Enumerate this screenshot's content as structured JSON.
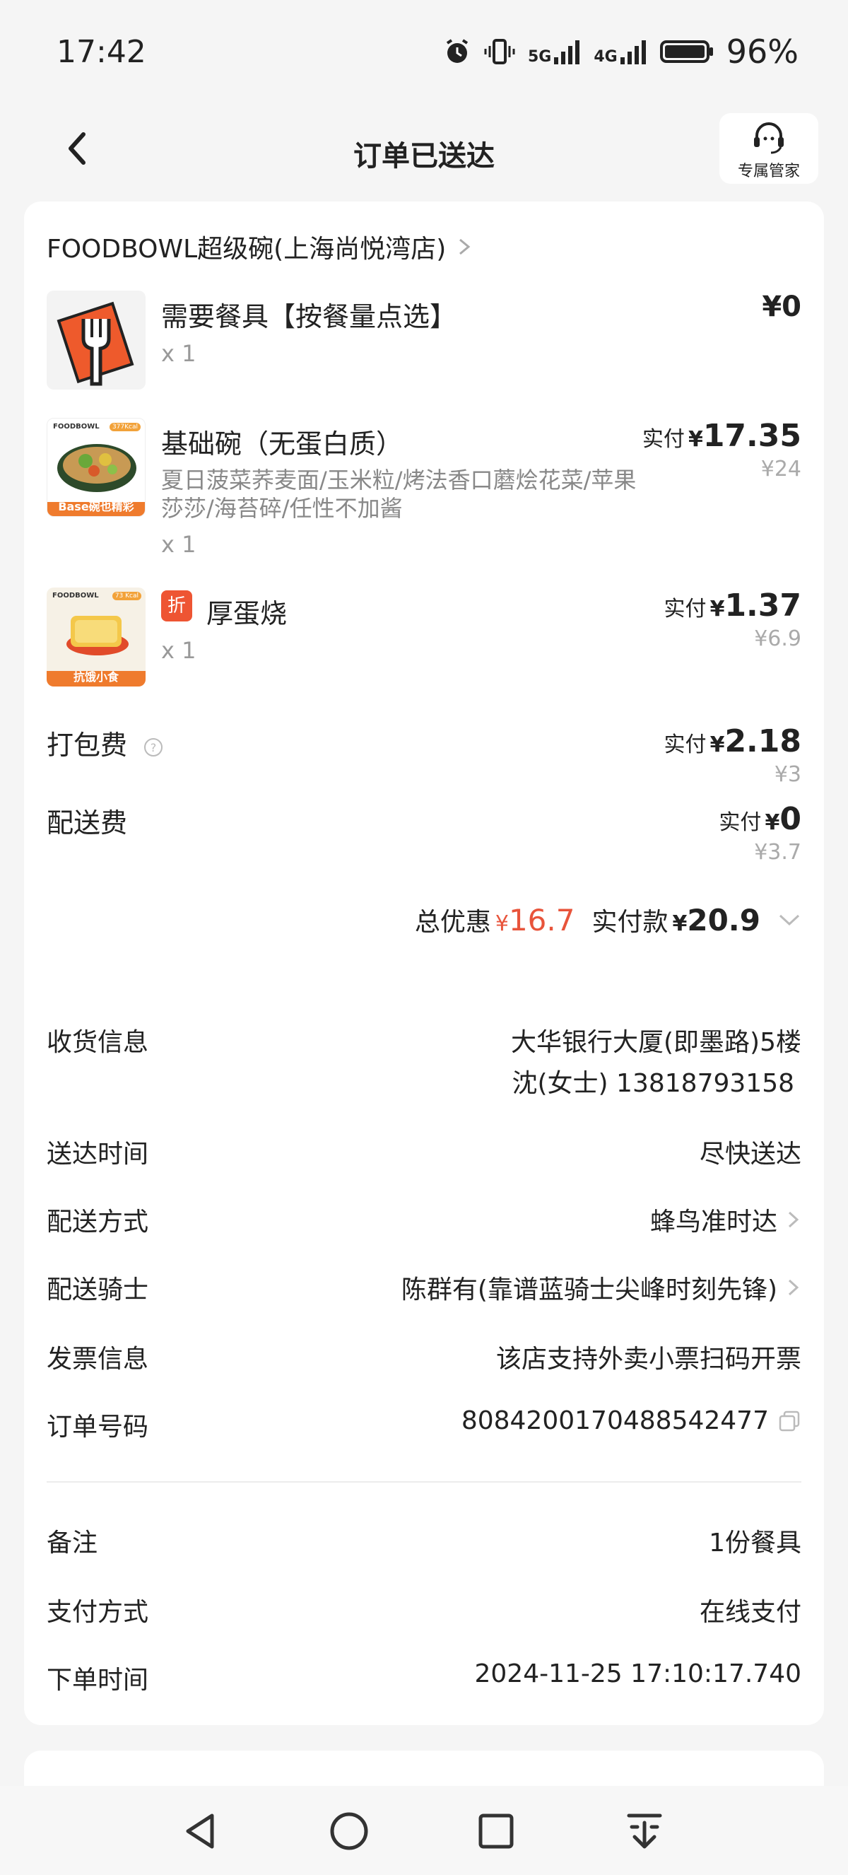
{
  "status_bar": {
    "time": "17:42",
    "signal_5g": "5G",
    "signal_4g": "4G",
    "battery": "96%"
  },
  "header": {
    "title": "订单已送达",
    "service_label": "专属管家"
  },
  "store": {
    "name": "FOODBOWL超级碗(上海尚悦湾店)"
  },
  "items": [
    {
      "name": "需要餐具【按餐量点选】",
      "qty": "x 1",
      "price": "¥0"
    },
    {
      "name": "基础碗（无蛋白质）",
      "desc": "夏日菠菜荞麦面/玉米粒/烤法香口蘑烩花菜/苹果莎莎/海苔碎/任性不加酱",
      "qty": "x 1",
      "pay_label": "实付",
      "pay_yen": "¥",
      "pay_value": "17.35",
      "original": "¥24",
      "thumb_brand": "FOODBOWL",
      "thumb_kcal": "377Kcal",
      "thumb_banner": "Base碗也精彩"
    },
    {
      "tag": "折",
      "name": "厚蛋烧",
      "qty": "x 1",
      "pay_label": "实付",
      "pay_yen": "¥",
      "pay_value": "1.37",
      "original": "¥6.9",
      "thumb_brand": "FOODBOWL",
      "thumb_kcal": "73 Kcal",
      "thumb_banner": "抗饿小食"
    }
  ],
  "fees": {
    "packing": {
      "label": "打包费",
      "pay_label": "实付",
      "pay_yen": "¥",
      "pay_value": "2.18",
      "original": "¥3"
    },
    "delivery": {
      "label": "配送费",
      "pay_label": "实付",
      "pay_yen": "¥",
      "pay_value": "0",
      "original": "¥3.7"
    }
  },
  "totals": {
    "discount_label": "总优惠",
    "discount_yen": "¥",
    "discount_value": "16.7",
    "paid_label": "实付款",
    "paid_yen": "¥",
    "paid_value": "20.9"
  },
  "info": {
    "receiver_label": "收货信息",
    "receiver_address": "大华银行大厦(即墨路)5楼",
    "receiver_contact": "沈(女士) 13818793158",
    "time_label": "送达时间",
    "time_value": "尽快送达",
    "method_label": "配送方式",
    "method_value": "蜂鸟准时达",
    "rider_label": "配送骑士",
    "rider_value": "陈群有(靠谱蓝骑士尖峰时刻先锋)",
    "invoice_label": "发票信息",
    "invoice_value": "该店支持外卖小票扫码开票",
    "order_label": "订单号码",
    "order_value": "8084200170488542477",
    "note_label": "备注",
    "note_value": "1份餐具",
    "payment_label": "支付方式",
    "payment_value": "在线支付",
    "created_label": "下单时间",
    "created_value": "2024-11-25 17:10:17.740"
  },
  "colors": {
    "accent_red": "#e8543b",
    "utensil_orange": "#ee5a2c"
  }
}
